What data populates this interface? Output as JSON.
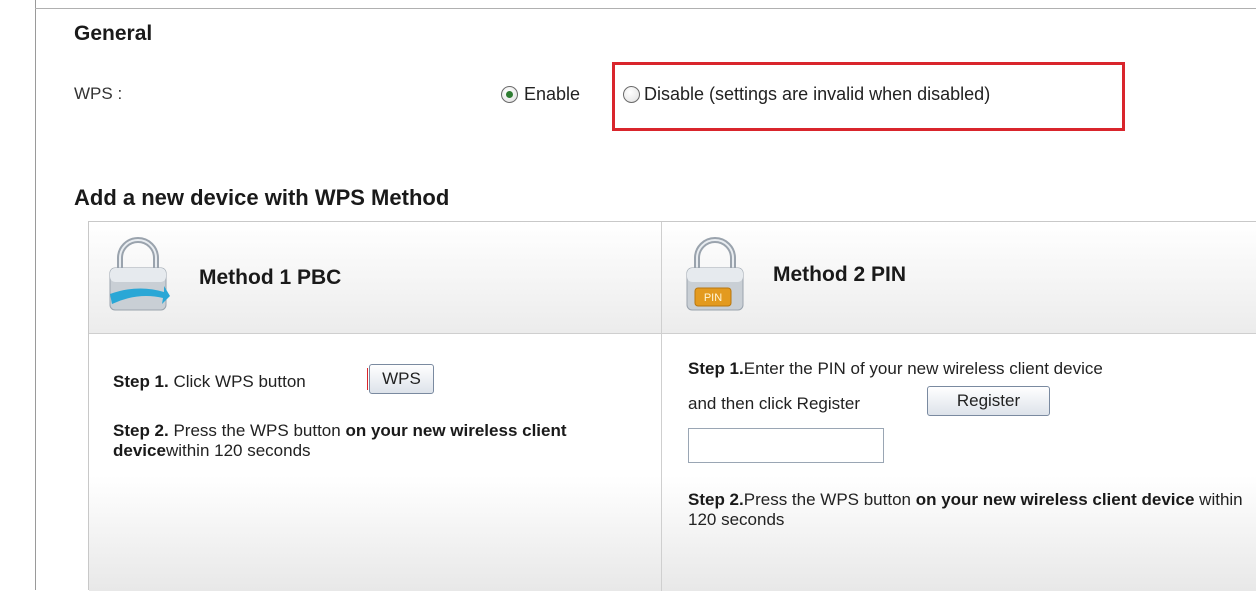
{
  "general": {
    "heading": "General",
    "wps_label": "WPS :",
    "enable_label": "Enable",
    "disable_label": "Disable (settings are invalid when disabled)",
    "selected": "Enable"
  },
  "add_device": {
    "heading": "Add a new device with WPS Method",
    "method1": {
      "title": "Method 1 PBC",
      "step1_prefix": "Step 1.",
      "step1_text": " Click WPS button",
      "wps_button_label": "WPS",
      "step2_prefix": "Step 2.",
      "step2_text": " Press the WPS button ",
      "step2_bold": "on your new wireless client device",
      "step2_suffix": "within 120 seconds"
    },
    "method2": {
      "title": "Method 2 PIN",
      "pin_badge": "PIN",
      "step1_prefix": "Step 1.",
      "step1_text": "Enter the PIN of your new wireless client device",
      "step1_line2": "and then click Register",
      "register_button_label": "Register",
      "pin_value": "",
      "step2_prefix": "Step 2.",
      "step2_text": "Press the WPS button ",
      "step2_bold": "on your new wireless client device",
      "step2_suffix": " within 120 seconds"
    }
  },
  "colors": {
    "highlight": "#d9252c",
    "radio_dot": "#2e7d32",
    "lock_arrow": "#2aa7d6",
    "pin_badge": "#e39a1f"
  }
}
